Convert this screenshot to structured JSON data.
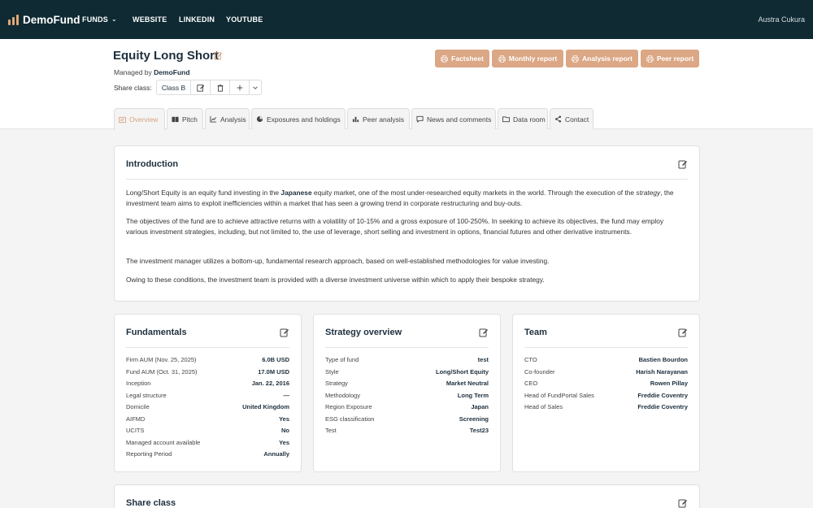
{
  "nav": {
    "logo_text": "DemoFund",
    "items": [
      "FUNDS",
      "WEBSITE",
      "LINKEDIN",
      "YOUTUBE"
    ],
    "user": "Austra Cukura"
  },
  "colors": {
    "nav_bg": "#0f2a33",
    "accent": "#dba785",
    "accent_text": "#d8a27e"
  },
  "fund": {
    "title": "Equity Long Short",
    "managed_prefix": "Managed by",
    "manager": "DemoFund",
    "share_class_label": "Share class:",
    "share_class": "Class B"
  },
  "reports": [
    "Factsheet",
    "Monthly report",
    "Analysis report",
    "Peer report"
  ],
  "tabs": [
    {
      "label": "Overview",
      "icon": "overview-icon"
    },
    {
      "label": "Pitch",
      "icon": "book-icon"
    },
    {
      "label": "Analysis",
      "icon": "chart-icon"
    },
    {
      "label": "Exposures and holdings",
      "icon": "pie-icon"
    },
    {
      "label": "Peer analysis",
      "icon": "bars-icon"
    },
    {
      "label": "News and comments",
      "icon": "comment-icon"
    },
    {
      "label": "Data room",
      "icon": "folder-icon"
    },
    {
      "label": "Contact",
      "icon": "share-icon"
    }
  ],
  "intro": {
    "title": "Introduction",
    "p1_a": "Long/Short Equity is an equity fund investing in the ",
    "p1_b": "Japanese",
    "p1_c": " equity market, one of the most under-researched equity markets in the world. Through the execution of the ",
    "p1_d": "strategy",
    "p1_e": ", the investment team aims to exploit inefficiencies within a market that has seen a growing trend in corporate restructuring and buy-outs.",
    "p2": "The objectives of the fund are to achieve attractive returns with a volatility of 10-15% and a gross exposure of 100-250%. In seeking to achieve its objectives, the fund may employ various investment strategies, including, but not limited to, the use of leverage, short selling and investment in options, financial futures and other derivative instruments.",
    "p3": "The investment manager utilizes a bottom-up, fundamental research approach, based on well-established methodologies for value investing.",
    "p4": "Owing to these conditions, the investment team is provided with a diverse investment universe within which to apply their bespoke strategy."
  },
  "fundamentals": {
    "title": "Fundamentals",
    "rows": [
      {
        "k": "Firm AUM (Nov. 25, 2025)",
        "v": "6.0B USD"
      },
      {
        "k": "Fund AUM (Oct. 31, 2025)",
        "v": "17.0M USD"
      },
      {
        "k": "Inception",
        "v": "Jan. 22, 2016"
      },
      {
        "k": "Legal structure",
        "v": "—"
      },
      {
        "k": "Domicile",
        "v": "United Kingdom"
      },
      {
        "k": "AIFMD",
        "v": "Yes"
      },
      {
        "k": "UCITS",
        "v": "No"
      },
      {
        "k": "Managed account available",
        "v": "Yes"
      },
      {
        "k": "Reporting Period",
        "v": "Annually"
      }
    ]
  },
  "strategy": {
    "title": "Strategy overview",
    "rows": [
      {
        "k": "Type of fund",
        "v": "test"
      },
      {
        "k": "Style",
        "v": "Long/Short Equity"
      },
      {
        "k": "Strategy",
        "v": "Market Neutral"
      },
      {
        "k": "Methodology",
        "v": "Long Term"
      },
      {
        "k": "Region Exposure",
        "v": "Japan"
      },
      {
        "k": "ESG classification",
        "v": "Screening"
      },
      {
        "k": "Test",
        "v": "Test23"
      }
    ]
  },
  "team": {
    "title": "Team",
    "rows": [
      {
        "k": "CTO",
        "v": "Bastien Bourdon"
      },
      {
        "k": "Co-founder",
        "v": "Harish Narayanan"
      },
      {
        "k": "CEO",
        "v": "Rowen Pillay"
      },
      {
        "k": "Head of FundPortal Sales",
        "v": "Freddie Coventry"
      },
      {
        "k": "Head of Sales",
        "v": "Freddie Coventry"
      }
    ]
  },
  "share_class_card": {
    "title": "Share class"
  }
}
